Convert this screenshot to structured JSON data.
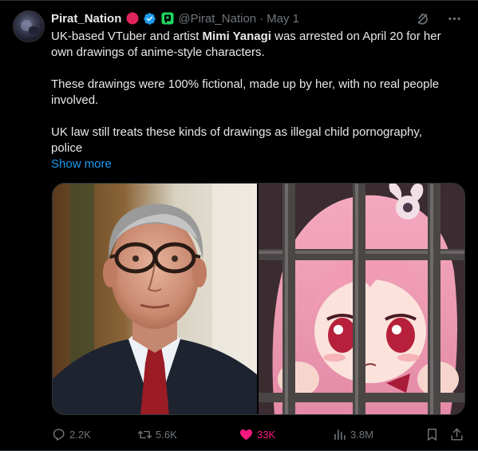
{
  "author": {
    "name": "Pirat_Nation",
    "handle": "@Pirat_Nation",
    "separator": "·",
    "date": "May 1"
  },
  "icons": {
    "avatar": "avatar-image",
    "badge_red": "red-circle-badge",
    "badge_verified": "verified-check-icon",
    "badge_green": "green-app-badge",
    "grok": "grok-icon",
    "more": "more-options-icon",
    "reply": "reply-icon",
    "retweet": "retweet-icon",
    "like": "heart-icon",
    "views": "views-icon",
    "bookmark": "bookmark-icon",
    "share": "share-icon"
  },
  "colors": {
    "background": "#000000",
    "text": "#e7e9ea",
    "muted": "#71767b",
    "link": "#1d9bf0",
    "like": "#f91880",
    "verified": "#1d9bf0"
  },
  "tweet": {
    "p1_a": "UK-based VTuber and artist ",
    "p1_bold": "Mimi Yanagi",
    "p1_b": " was arrested on April 20 for her own drawings of anime-style characters.",
    "p2": "These drawings were 100% fictional, made up by her, with no real people involved.",
    "p3": "UK law still treats these kinds of drawings as illegal child pornography, police",
    "show_more": "Show more"
  },
  "media": {
    "left": "photo-man-glasses",
    "right": "anime-girl-behind-bars"
  },
  "stats": {
    "replies": "2.2K",
    "retweets": "5.6K",
    "likes": "33K",
    "views": "3.8M"
  }
}
